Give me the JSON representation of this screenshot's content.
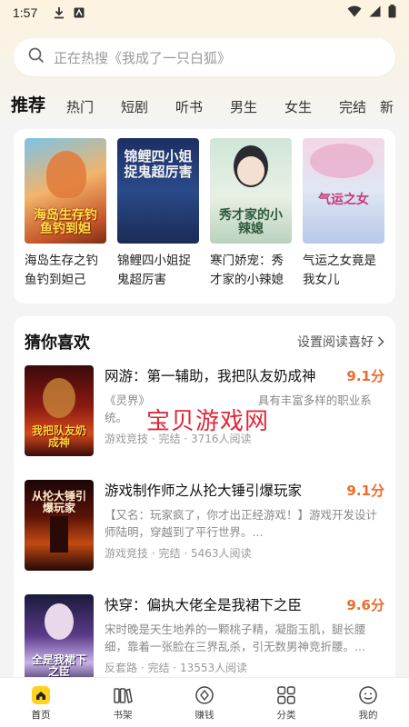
{
  "status_bar": {
    "time": "1:57"
  },
  "search": {
    "placeholder": "正在热搜《我成了一只白狐》"
  },
  "tabs": [
    "推荐",
    "热门",
    "短剧",
    "听书",
    "男生",
    "女生",
    "完结",
    "新"
  ],
  "recommend": [
    {
      "title": "海岛生存之钓鱼钓到妲己",
      "cover_text": "海岛生存钓鱼钓到妲"
    },
    {
      "title": "锦鲤四小姐捉鬼超厉害",
      "cover_text": "锦鲤四小姐捉鬼超厉害"
    },
    {
      "title": "寒门娇宠：秀才家的小辣媳",
      "cover_text": "秀才家的小辣媳"
    },
    {
      "title": "气运之女竟是我女儿",
      "cover_text": "气运之女"
    }
  ],
  "guess": {
    "title": "猜你喜欢",
    "preference_link": "设置阅读喜好",
    "books": [
      {
        "name": "网游：第一辅助，我把队友奶成神",
        "score": "9.1分",
        "desc": "《灵界》　　　　　　　　　　具有丰富多样的职业系统。",
        "category": "游戏竞技",
        "status": "完结",
        "readers": "3716人阅读",
        "cover_text": "我把队友奶成神"
      },
      {
        "name": "游戏制作师之从抡大锤引爆玩家",
        "score": "9.1分",
        "desc": "【又名：玩家疯了，你才出正经游戏！】游戏开发设计师陆明，穿越到了平行世界。...",
        "category": "游戏竞技",
        "status": "完结",
        "readers": "5463人阅读",
        "cover_text": "从抡大锤引爆玩家"
      },
      {
        "name": "快穿：偏执大佬全是我裙下之臣",
        "score": "9.6分",
        "desc": "宋时晚是天生地养的一颗桃子精，凝脂玉肌，腿长腰细，靠着一张脸在三界乱杀，引无数男神竞折腰。...",
        "category": "反套路",
        "status": "完结",
        "readers": "13553人阅读",
        "cover_text": "全是我裙下之臣"
      }
    ]
  },
  "watermark": "宝贝游戏网",
  "bottom_nav": [
    {
      "label": "首页",
      "icon": "home-icon"
    },
    {
      "label": "书架",
      "icon": "bookshelf-icon"
    },
    {
      "label": "赚钱",
      "icon": "coin-icon"
    },
    {
      "label": "分类",
      "icon": "category-icon"
    },
    {
      "label": "我的",
      "icon": "profile-icon"
    }
  ],
  "colors": {
    "accent": "#f06a28",
    "watermark": "#e0283a"
  }
}
